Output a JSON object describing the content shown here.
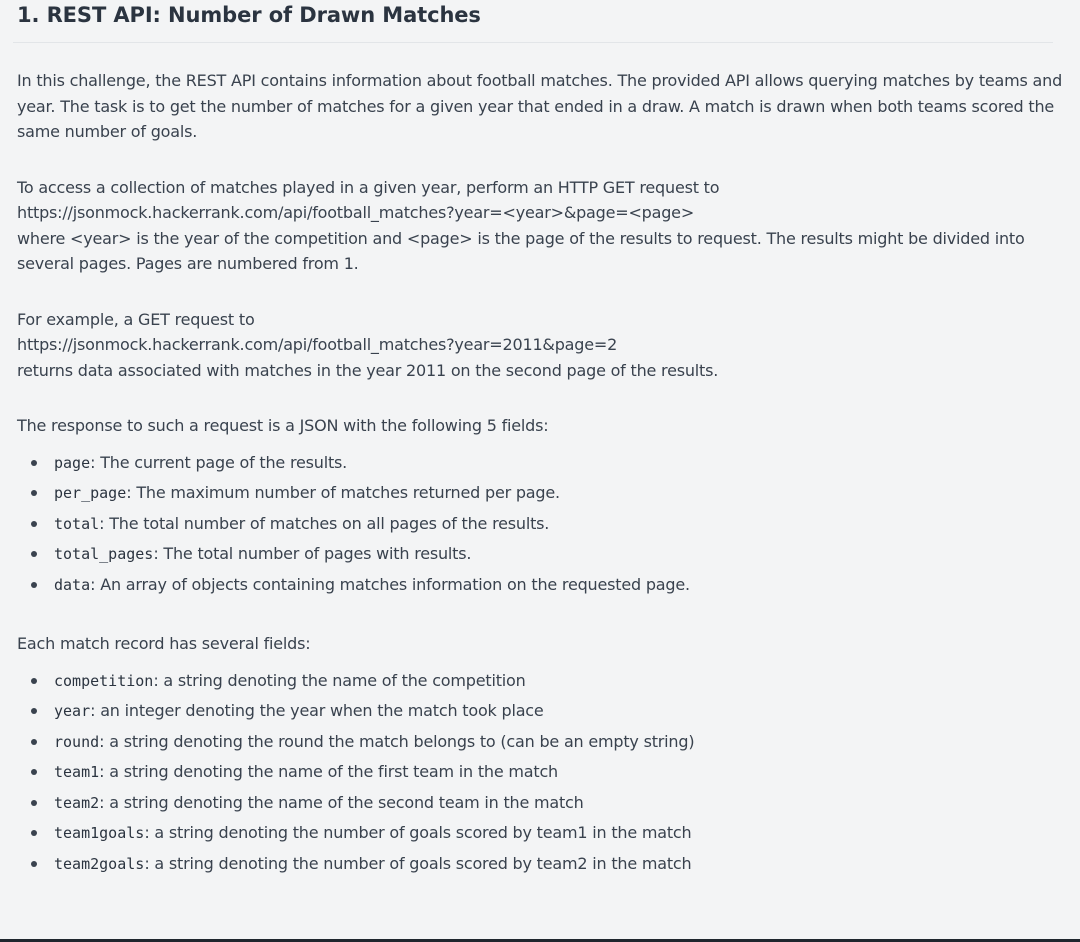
{
  "title": "1. REST API: Number of Drawn Matches",
  "paragraphs": {
    "intro": "In this challenge, the REST API contains information about football matches. The provided API allows querying matches by teams and year. The task is to get the number of matches for a given year that ended in a draw. A match is drawn when both teams scored the same number of goals.",
    "access_line1": "To access a collection of matches played in a given year, perform an HTTP GET request to",
    "access_url": "https://jsonmock.hackerrank.com/api/football_matches?year=<year>&page=<page>",
    "access_line3": "where <year> is the year of the competition and <page> is the page of the results to request. The results might be divided into several pages. Pages are numbered from 1.",
    "example_line1": "For example, a GET request to",
    "example_url": "https://jsonmock.hackerrank.com/api/football_matches?year=2011&page=2",
    "example_line3": "returns data associated with matches in the year 2011 on the second page of the results.",
    "response_intro": "The response to such a request is a JSON with the following 5 fields:",
    "record_intro": "Each match record has several fields:"
  },
  "response_fields": [
    {
      "name": "page",
      "desc": ": The current page of the results."
    },
    {
      "name": "per_page",
      "desc": ": The maximum number of matches returned per page."
    },
    {
      "name": "total",
      "desc": ": The total number of matches on all pages of the results."
    },
    {
      "name": "total_pages",
      "desc": ": The total number of pages with results."
    },
    {
      "name": "data",
      "desc": ": An array of objects containing matches information on the requested page."
    }
  ],
  "record_fields": [
    {
      "name": "competition",
      "desc": ": a string denoting the name of the competition"
    },
    {
      "name": "year",
      "desc": ": an integer denoting the year when the match took place"
    },
    {
      "name": "round",
      "desc": ": a string denoting the round the match belongs to (can be an empty string)"
    },
    {
      "name": "team1",
      "desc": ": a string denoting the name of the first team in the match"
    },
    {
      "name": "team2",
      "desc": ": a string denoting the name of the second team in the match"
    },
    {
      "name": "team1goals",
      "desc": ": a string denoting the number of goals scored by team1 in the match"
    },
    {
      "name": "team2goals",
      "desc": ": a string denoting the number of goals scored by team2 in the match"
    }
  ]
}
